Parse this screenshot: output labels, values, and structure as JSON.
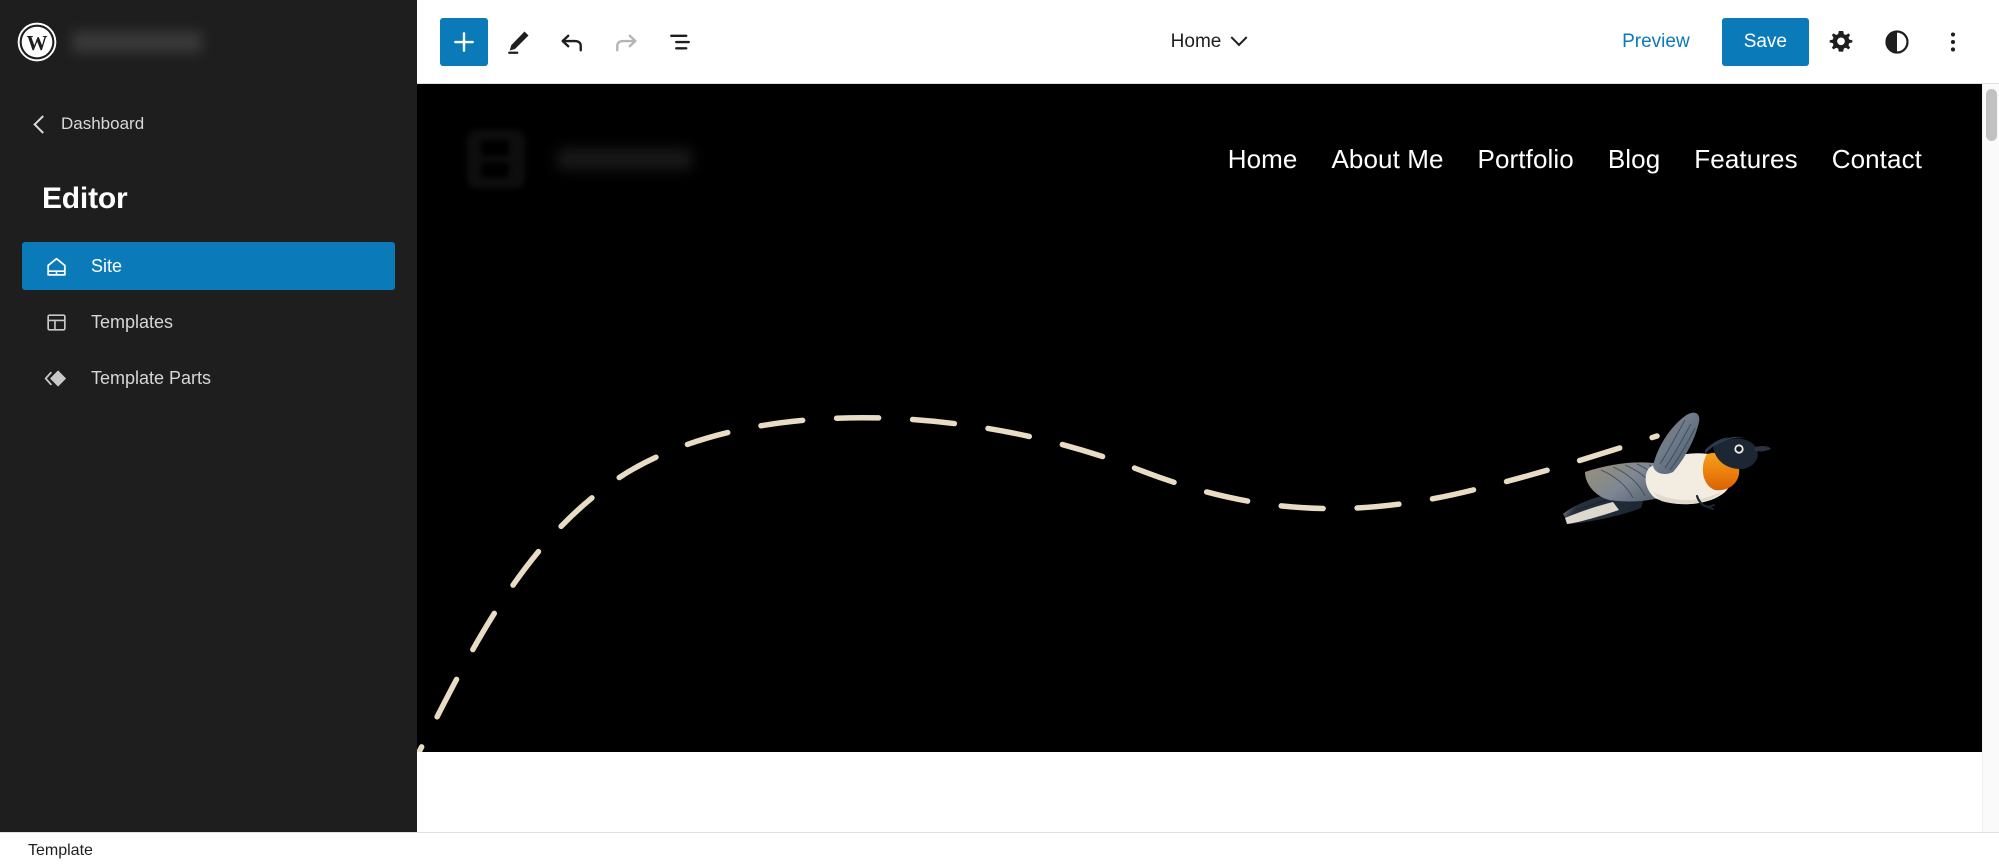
{
  "app": {
    "name": "WordPress Site Editor",
    "accent_color": "#0b7ab8",
    "sidebar_bg": "#1e1e1e",
    "hero_bg": "#000000"
  },
  "sidebar": {
    "wp_logo_icon": "wordpress-logo-icon",
    "site_name": "",
    "site_name_redacted": true,
    "back_link": {
      "label": "Dashboard",
      "icon": "chevron-left-icon"
    },
    "heading": "Editor",
    "items": [
      {
        "label": "Site",
        "icon": "home-icon",
        "active": true
      },
      {
        "label": "Templates",
        "icon": "layout-icon",
        "active": false
      },
      {
        "label": "Template Parts",
        "icon": "template-parts-icon",
        "active": false
      }
    ]
  },
  "toolbar": {
    "left_buttons": [
      {
        "name": "add-block-button",
        "icon": "plus-icon",
        "label": "Add block",
        "primary": true,
        "disabled": false
      },
      {
        "name": "edit-tool-button",
        "icon": "pencil-icon",
        "label": "Edit",
        "primary": false,
        "disabled": false
      },
      {
        "name": "undo-button",
        "icon": "undo-icon",
        "label": "Undo",
        "primary": false,
        "disabled": false
      },
      {
        "name": "redo-button",
        "icon": "redo-icon",
        "label": "Redo",
        "primary": false,
        "disabled": true
      },
      {
        "name": "list-view-button",
        "icon": "list-view-icon",
        "label": "Document Overview",
        "primary": false,
        "disabled": false
      }
    ],
    "document_title": "Home",
    "document_title_chevron": "chevron-down-icon",
    "preview_label": "Preview",
    "save_label": "Save",
    "right_icons": [
      {
        "name": "settings-button",
        "icon": "gear-icon",
        "label": "Settings"
      },
      {
        "name": "styles-button",
        "icon": "contrast-icon",
        "label": "Styles"
      },
      {
        "name": "options-button",
        "icon": "three-dots-vertical-icon",
        "label": "Options"
      }
    ]
  },
  "canvas": {
    "site_header": {
      "logo_icon": "site-logo-icon",
      "site_title": "",
      "site_title_redacted": true,
      "nav_items": [
        {
          "label": "Home"
        },
        {
          "label": "About Me"
        },
        {
          "label": "Portfolio"
        },
        {
          "label": "Blog"
        },
        {
          "label": "Features"
        },
        {
          "label": "Contact"
        }
      ]
    },
    "hero": {
      "background_color": "#000000",
      "flight_path_color": "#e8dcc4",
      "bird_image_alt": "illustration of a flying bird with orange throat"
    }
  },
  "scrollbar": {
    "name": "canvas-scrollbar",
    "thumb_position": "top"
  },
  "footer": {
    "label": "Template"
  }
}
